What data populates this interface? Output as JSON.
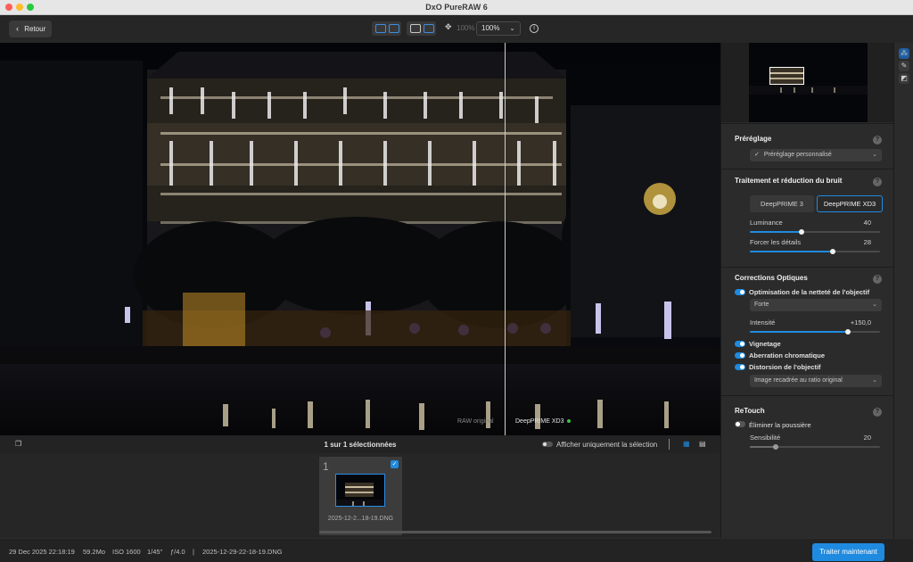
{
  "window": {
    "title": "DxO PureRAW 6"
  },
  "toolbar": {
    "back_label": "Retour",
    "zoom_disabled": "100%",
    "zoom_value": "100%"
  },
  "viewer": {
    "label_left": "RAW original",
    "label_right": "DeepPRIME XD3"
  },
  "filmstrip": {
    "selection_count": "1 sur 1 sélectionnées",
    "only_selection_label": "Afficher uniquement la sélection",
    "thumbnails": [
      {
        "index": "1",
        "filename": "2025-12-2...18-19.DNG",
        "checked": true
      }
    ]
  },
  "status": {
    "date": "29 Dec 2025 22:18:19",
    "size": "59.2Mo",
    "iso": "ISO 1600",
    "shutter": "1/45\"",
    "aperture": "ƒ/4.0",
    "separator": "|",
    "filename": "2025-12-29-22-18-19.DNG",
    "process_button": "Traiter maintenant"
  },
  "panel": {
    "preset": {
      "title": "Préréglage",
      "value": "Préréglage personnalisé"
    },
    "denoise": {
      "title": "Traitement et réduction du bruit",
      "options": [
        "DeepPRIME 3",
        "DeepPRIME XD3"
      ],
      "selected": "DeepPRIME XD3",
      "luminance_label": "Luminance",
      "luminance_value": "40",
      "luminance_fraction": 0.4,
      "details_label": "Forcer les détails",
      "details_value": "28",
      "details_fraction": 0.64
    },
    "optics": {
      "title": "Corrections Optiques",
      "sharpness_label": "Optimisation de la netteté de l'objectif",
      "sharpness_mode": "Forte",
      "intensity_label": "Intensité",
      "intensity_value": "+150,0",
      "intensity_fraction": 0.75,
      "vignetting_label": "Vignetage",
      "chromatic_label": "Aberration chromatique",
      "distortion_label": "Distorsion de l'objectif",
      "distortion_mode": "Image recadrée au ratio original"
    },
    "retouch": {
      "title": "ReTouch",
      "dust_label": "Éliminer la poussière",
      "sensitivity_label": "Sensibilité",
      "sensitivity_value": "20",
      "sensitivity_fraction": 0.2
    }
  }
}
